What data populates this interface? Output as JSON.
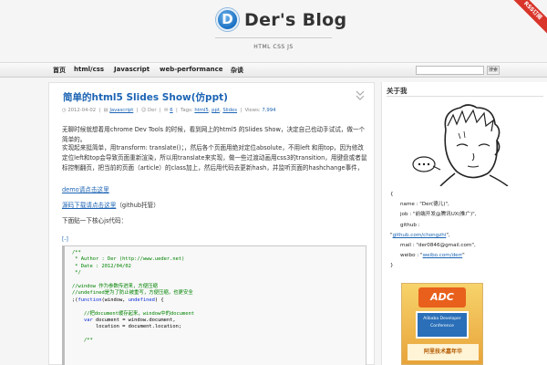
{
  "header": {
    "logo_letter": "D",
    "title": "Der's Blog",
    "subtitle": "HTML CSS JS",
    "rss_label": "RSS订阅"
  },
  "nav": {
    "items": [
      "首页",
      "html/css",
      "Javascript",
      "web-performance",
      "杂谈"
    ],
    "search_placeholder": "",
    "search_button": "搜索"
  },
  "post": {
    "title": "简单的html5 Slides Show(仿ppt)",
    "date": "2012-04-02",
    "category": "Javascript",
    "author": "Der",
    "comments": "6",
    "tags_label": "Tags:",
    "tags": [
      "html5",
      "ppt",
      "Slides"
    ],
    "views_label": "Views:",
    "views": "7,994",
    "para1": "无聊时候就想着用chrome Dev Tools 的时候，看到网上的html5 的Slides Show，决定自己也动手试试，做一个简单的。",
    "para2": "实现起来挺简单，用transform: translate()；，然后各个页面用绝对定位absolute，不用left 和用top，因为修改定位left和top会导致页面重新渲染，所以用translate来实现，做一些过渡动画用css3的transition，用键盘或者鼠标控制翻页，把当前的页面（article）的class加上，然后用代码去更新hash，并监听页面的hashchange事件，如果用户刷新页面，就读取hash，并触发hashchange事件来跳转到对应页面。",
    "demo_link": "demo请点击这里",
    "download_link": "源码下载请点击这里",
    "download_suffix": "（github托管）",
    "js_intro": "下面贴一下核心js代码：",
    "expand": "[-]",
    "code_lines": [
      {
        "t": "/**",
        "c": "com"
      },
      {
        "t": " * Author : Der (http://www.ueder.net)",
        "c": "com"
      },
      {
        "t": " * Date : 2012/04/02",
        "c": "com"
      },
      {
        "t": " */",
        "c": "com"
      },
      {
        "t": "",
        "c": ""
      },
      {
        "t": "//window 作为参数传进来，方便压缩",
        "c": "com"
      },
      {
        "t": "//undefined是为了防止被重写，方便压缩，也更安全",
        "c": "com"
      },
      {
        "t": ";(function(window, undefined) {",
        "c": "fn"
      },
      {
        "t": "",
        "c": ""
      },
      {
        "t": "    //把document缓存起来，window中的document",
        "c": "com"
      },
      {
        "t": "    var document = window.document,",
        "c": "var"
      },
      {
        "t": "        location = document.location;",
        "c": ""
      },
      {
        "t": "",
        "c": ""
      },
      {
        "t": "    /**",
        "c": "com"
      }
    ]
  },
  "sidebar": {
    "title": "关于我",
    "profile_open": "{",
    "name_line": "name : \"Der(德儿)\",",
    "job_line": "job : \"前端开发@腾讯UX(推广)\",",
    "github_label": "github :",
    "github_link": "github.com/chongzhi",
    "github_prefix": "\"",
    "github_suffix": "\",",
    "mail_line": "mail : \"der0846@gmail.com\",",
    "weibo_prefix": "weibo : \"",
    "weibo_link": "weibo.com/derr",
    "weibo_suffix": "\"",
    "profile_close": "}",
    "ad": {
      "logo": "ADC",
      "line1": "Alibaba Developer",
      "line2": "Conference",
      "bottom": "阿里技术嘉年华"
    }
  }
}
